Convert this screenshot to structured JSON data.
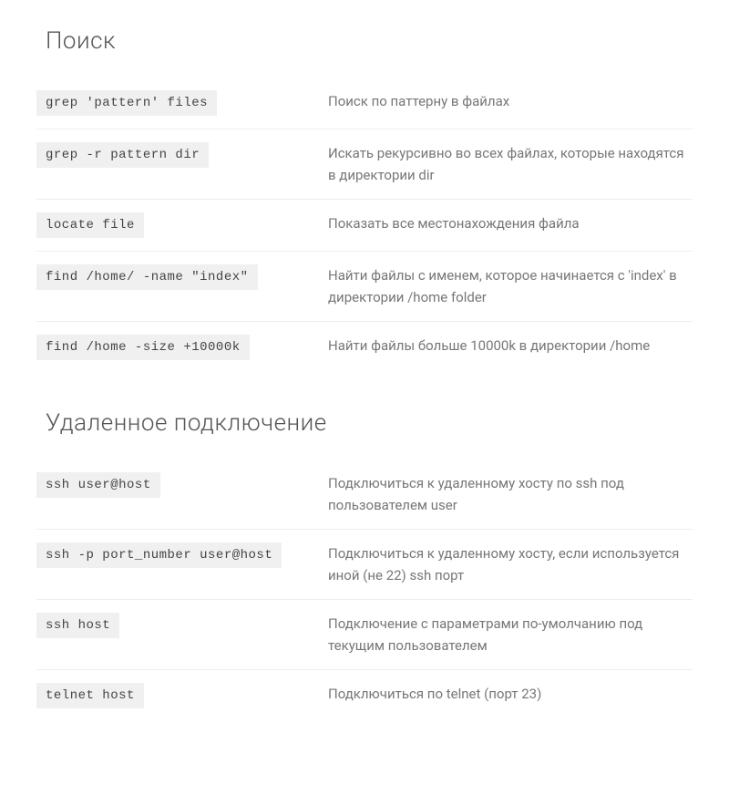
{
  "sections": [
    {
      "title": "Поиск",
      "rows": [
        {
          "cmd": "grep 'pattern' files",
          "desc": "Поиск по паттерну в файлах"
        },
        {
          "cmd": "grep -r pattern dir",
          "desc": "Искать рекурсивно во всех файлах, которые находятся в директории dir"
        },
        {
          "cmd": "locate file",
          "desc": "Показать все местонахождения файла"
        },
        {
          "cmd": "find /home/ -name \"index\"",
          "desc": "Найти файлы с именем, которое начинается с 'index' в директории /home folder"
        },
        {
          "cmd": "find /home -size +10000k",
          "desc": "Найти файлы больше 10000k в директории /home"
        }
      ]
    },
    {
      "title": "Удаленное подключение",
      "rows": [
        {
          "cmd": "ssh user@host",
          "desc": "Подключиться к удаленному хосту по ssh под пользователем user"
        },
        {
          "cmd": "ssh -p port_number user@host",
          "desc": "Подключиться к удаленному хосту, если используется иной (не 22) ssh порт"
        },
        {
          "cmd": "ssh host",
          "desc": "Подключение с параметрами по-умолчанию под текущим пользователем"
        },
        {
          "cmd": "telnet host",
          "desc": "Подключиться по telnet (порт 23)"
        }
      ]
    }
  ]
}
